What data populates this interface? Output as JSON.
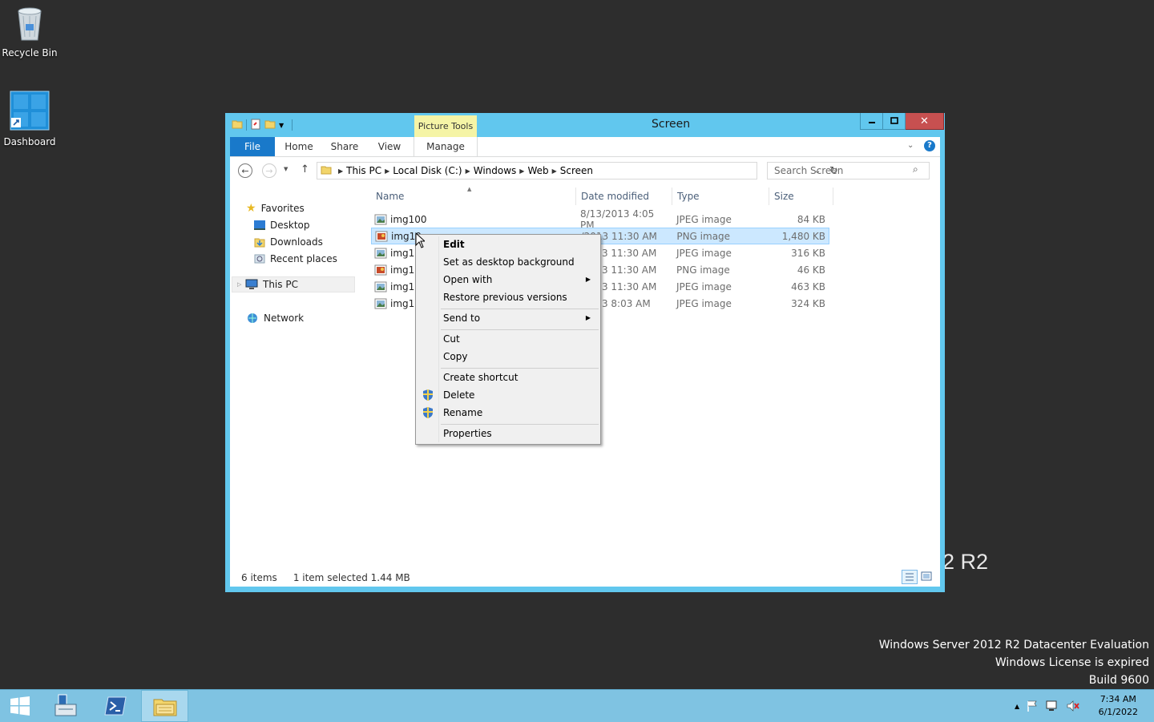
{
  "desktop": {
    "icons": [
      {
        "label": "Recycle Bin"
      },
      {
        "label": "Dashboard"
      }
    ],
    "watermark": {
      "line1": "Windows Server 2012 R2 Datacenter Evaluation",
      "line2": "Windows License is expired",
      "line3": "Build 9600",
      "r2": "2 R2"
    }
  },
  "window": {
    "title": "Screen",
    "context_tab": "Picture Tools",
    "tabs": [
      "File",
      "Home",
      "Share",
      "View",
      "Manage"
    ],
    "address": [
      "This PC",
      "Local Disk (C:)",
      "Windows",
      "Web",
      "Screen"
    ],
    "search_placeholder": "Search Screen",
    "nav": {
      "favorites": "Favorites",
      "desktop": "Desktop",
      "downloads": "Downloads",
      "recent": "Recent places",
      "this_pc": "This PC",
      "network": "Network"
    },
    "columns": [
      "Name",
      "Date modified",
      "Type",
      "Size"
    ],
    "files": [
      {
        "name": "img100",
        "date": "8/13/2013 4:05 PM",
        "type": "JPEG image",
        "size": "84 KB",
        "icon": "jpeg-icon"
      },
      {
        "name": "img10",
        "date": "/2013 11:30 AM",
        "type": "PNG image",
        "size": "1,480 KB",
        "icon": "png-icon"
      },
      {
        "name": "img10",
        "date": "/2013 11:30 AM",
        "type": "JPEG image",
        "size": "316 KB",
        "icon": "jpeg-icon"
      },
      {
        "name": "img10",
        "date": "/2013 11:30 AM",
        "type": "PNG image",
        "size": "46 KB",
        "icon": "png-icon"
      },
      {
        "name": "img10",
        "date": "/2013 11:30 AM",
        "type": "JPEG image",
        "size": "463 KB",
        "icon": "jpeg-icon"
      },
      {
        "name": "img10",
        "date": "/2013 8:03 AM",
        "type": "JPEG image",
        "size": "324 KB",
        "icon": "jpeg-icon"
      }
    ],
    "status": {
      "items": "6 items",
      "selected": "1 item selected  1.44 MB"
    }
  },
  "context_menu": {
    "edit": "Edit",
    "set_bg": "Set as desktop background",
    "open_with": "Open with",
    "restore": "Restore previous versions",
    "send_to": "Send to",
    "cut": "Cut",
    "copy": "Copy",
    "create_shortcut": "Create shortcut",
    "delete": "Delete",
    "rename": "Rename",
    "properties": "Properties"
  },
  "taskbar": {
    "time": "7:34 AM",
    "date": "6/1/2022"
  },
  "colors": {
    "frame": "#61c7ee",
    "accent": "#1979ca",
    "taskbar": "#7fc3e2",
    "selection": "#cce8ff",
    "desktop": "#2d2d2d"
  }
}
